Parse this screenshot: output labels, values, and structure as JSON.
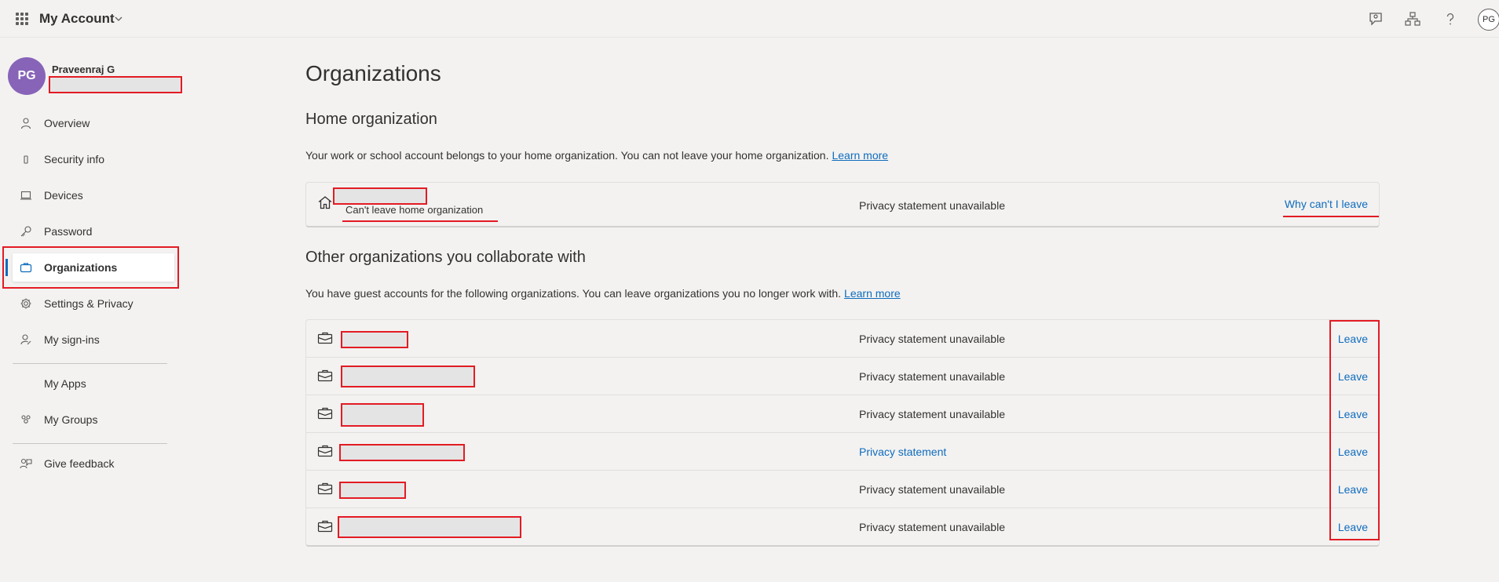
{
  "header": {
    "app_title": "My Account",
    "avatar_initials": "PG",
    "icons": [
      "feedback-icon",
      "org-chart-icon",
      "help-icon"
    ]
  },
  "sidebar": {
    "user": {
      "initials": "PG",
      "name": "Praveenraj G"
    },
    "items": [
      {
        "label": "Overview",
        "icon": "person-icon"
      },
      {
        "label": "Security info",
        "icon": "phone-icon"
      },
      {
        "label": "Devices",
        "icon": "laptop-icon"
      },
      {
        "label": "Password",
        "icon": "key-icon"
      },
      {
        "label": "Organizations",
        "icon": "briefcase-icon",
        "active": true
      },
      {
        "label": "Settings & Privacy",
        "icon": "gear-icon"
      },
      {
        "label": "My sign-ins",
        "icon": "sign-in-icon"
      }
    ],
    "secondary": [
      {
        "label": "My Apps"
      },
      {
        "label": "My Groups",
        "icon": "groups-icon"
      }
    ],
    "feedback": {
      "label": "Give feedback",
      "icon": "feedback-icon"
    }
  },
  "main": {
    "title": "Organizations",
    "home": {
      "title": "Home organization",
      "description": "Your work or school account belongs to your home organization. You can not leave your home organization.",
      "learn_more": "Learn more",
      "subtitle": "Can't leave home organization",
      "privacy": "Privacy statement unavailable",
      "action": "Why can't I leave"
    },
    "other": {
      "title": "Other organizations you collaborate with",
      "description": "You have guest accounts for the following organizations. You can leave organizations you no longer work with.",
      "learn_more": "Learn more",
      "rows": [
        {
          "privacy": "Privacy statement unavailable",
          "privacy_is_link": false,
          "action": "Leave"
        },
        {
          "privacy": "Privacy statement unavailable",
          "privacy_is_link": false,
          "action": "Leave"
        },
        {
          "privacy": "Privacy statement unavailable",
          "privacy_is_link": false,
          "action": "Leave"
        },
        {
          "privacy": "Privacy statement",
          "privacy_is_link": true,
          "action": "Leave"
        },
        {
          "privacy": "Privacy statement unavailable",
          "privacy_is_link": false,
          "action": "Leave"
        },
        {
          "privacy": "Privacy statement unavailable",
          "privacy_is_link": false,
          "action": "Leave"
        }
      ]
    }
  },
  "colors": {
    "accent": "#0f6cbd",
    "avatar": "#8764b8",
    "annotation": "#e31b23"
  }
}
